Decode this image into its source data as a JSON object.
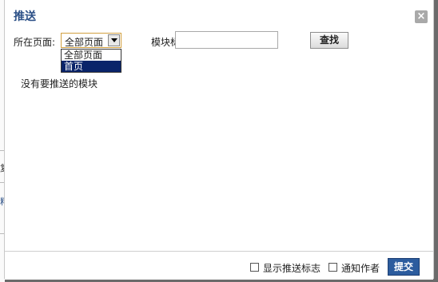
{
  "dialog": {
    "title": "推送",
    "close_glyph": "×"
  },
  "filter": {
    "page_label": "所在页面:",
    "page_select_value": "全部页面",
    "page_options": [
      "全部页面",
      "首页"
    ],
    "module_label": "模块标识:",
    "module_input_value": "",
    "find_label": "查找"
  },
  "result": {
    "empty_message": "没有要推送的模块"
  },
  "footer": {
    "show_flag_label": "显示推送标志",
    "notify_author_label": "通知作者",
    "submit_label": "提交"
  },
  "background": {
    "fragment_1": "复",
    "fragment_2": "料"
  }
}
